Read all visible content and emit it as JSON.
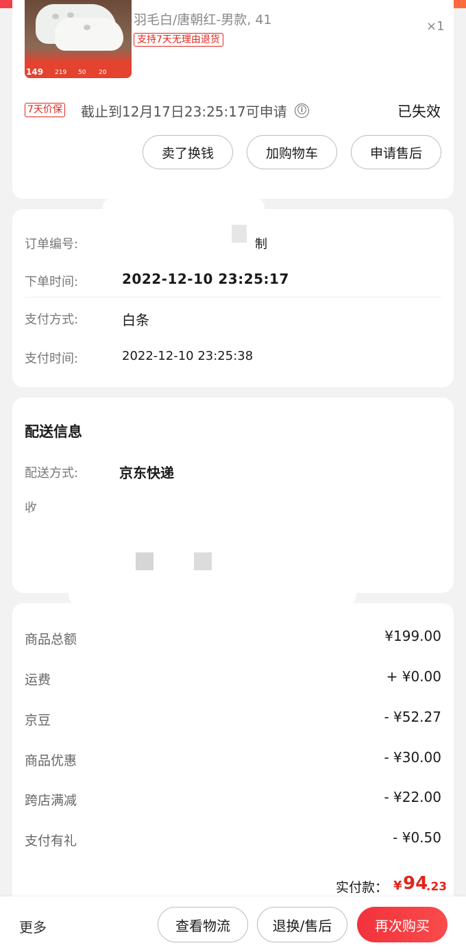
{
  "product": {
    "thumb_price": "149",
    "thumb_nums": [
      "219",
      "50",
      "20"
    ],
    "spec": "羽毛白/唐朝红-男款, 41",
    "quantity": "×1",
    "return_tag": "支持7天无理由退货"
  },
  "price_protect": {
    "tag": "7天价保",
    "text": "截止到12月17日23:25:17可申请",
    "info_icon": "ⓘ",
    "status": "已失效"
  },
  "item_actions": [
    "卖了换钱",
    "加购物车",
    "申请售后"
  ],
  "order_info": {
    "order_no_label": "订单编号:",
    "order_no_partial": "制",
    "order_time_label": "下单时间:",
    "order_time": "2022-12-10 23:25:17",
    "pay_method_label": "支付方式:",
    "pay_method": "白条",
    "pay_time_label": "支付时间:",
    "pay_time": "2022-12-10 23:25:38"
  },
  "delivery": {
    "title": "配送信息",
    "method_label": "配送方式:",
    "method": "京东快递",
    "receiver_label_partial": "收"
  },
  "amounts": {
    "rows": [
      {
        "label": "商品总额",
        "value": "¥199.00"
      },
      {
        "label": "运费",
        "value": "+ ¥0.00"
      },
      {
        "label": "京豆",
        "value": "- ¥52.27"
      },
      {
        "label": "商品优惠",
        "value": "- ¥30.00"
      },
      {
        "label": "跨店满减",
        "value": "- ¥22.00"
      },
      {
        "label": "支付有礼",
        "value": "- ¥0.50"
      }
    ],
    "total_label": "实付款：",
    "total_currency": "¥",
    "total_int": "94",
    "total_dec": ".23"
  },
  "bottom_bar": {
    "more": "更多",
    "logistics": "查看物流",
    "return": "退换/售后",
    "rebuy": "再次购买"
  },
  "colors": {
    "accent": "#e1251b",
    "rebuy_button": "#f1323d"
  }
}
